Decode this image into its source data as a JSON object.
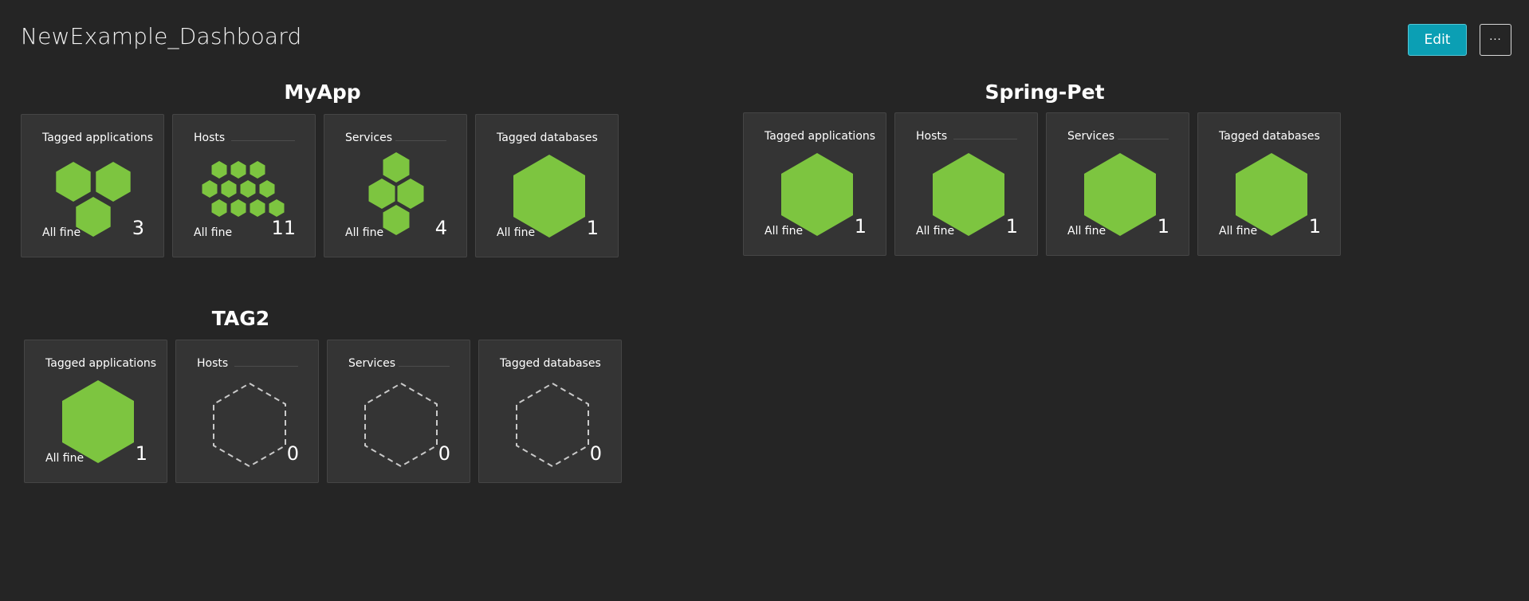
{
  "header": {
    "title": "NewExample_Dashboard",
    "edit_label": "Edit",
    "more_label": "···"
  },
  "colors": {
    "background": "#252525",
    "tile": "#343434",
    "healthy": "#7dc540",
    "accent": "#0b9fb4"
  },
  "groups": [
    {
      "title": "MyApp",
      "tiles": [
        {
          "title": "Tagged applications",
          "status": "All fine",
          "count": "3",
          "icon": "hex-cluster-3-icon"
        },
        {
          "title": "Hosts",
          "status": "All fine",
          "count": "11",
          "icon": "hex-cluster-11-icon"
        },
        {
          "title": "Services",
          "status": "All fine",
          "count": "4",
          "icon": "hex-cluster-4-icon"
        },
        {
          "title": "Tagged databases",
          "status": "All fine",
          "count": "1",
          "icon": "hexagon-icon"
        }
      ]
    },
    {
      "title": "Spring-Pet",
      "tiles": [
        {
          "title": "Tagged applications",
          "status": "All fine",
          "count": "1",
          "icon": "hexagon-icon"
        },
        {
          "title": "Hosts",
          "status": "All fine",
          "count": "1",
          "icon": "hexagon-icon"
        },
        {
          "title": "Services",
          "status": "All fine",
          "count": "1",
          "icon": "hexagon-icon"
        },
        {
          "title": "Tagged databases",
          "status": "All fine",
          "count": "1",
          "icon": "hexagon-icon"
        }
      ]
    },
    {
      "title": "TAG2",
      "tiles": [
        {
          "title": "Tagged applications",
          "status": "All fine",
          "count": "1",
          "icon": "hexagon-icon"
        },
        {
          "title": "Hosts",
          "count": "0",
          "icon": "empty-hexagon-icon"
        },
        {
          "title": "Services",
          "count": "0",
          "icon": "empty-hexagon-icon"
        },
        {
          "title": "Tagged databases",
          "count": "0",
          "icon": "empty-hexagon-icon"
        }
      ]
    }
  ]
}
